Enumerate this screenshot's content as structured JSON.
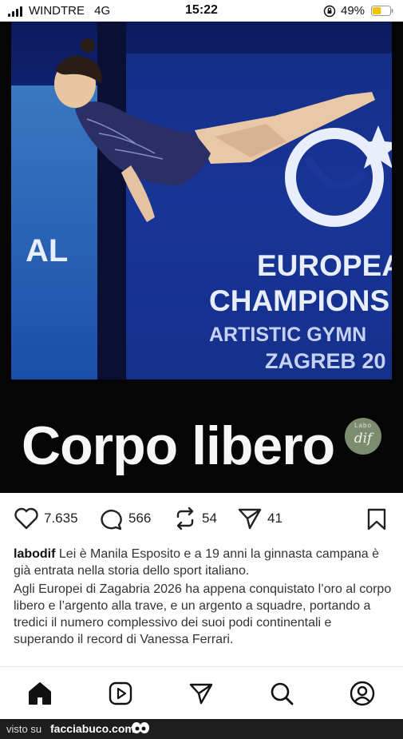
{
  "status_bar": {
    "carrier": "WINDTRE",
    "network": "4G",
    "time": "15:22",
    "battery_percent": "49%",
    "battery_level": 0.49
  },
  "post": {
    "overlay_title": "Corpo libero",
    "photo_text": {
      "line1": "EUROPEA",
      "line2": "CHAMPIONS",
      "line3": "ARTISTIC GYMN",
      "line4": "ZAGREB 20",
      "side": "AL"
    },
    "logo": {
      "top": "Labo",
      "mark": "dif"
    }
  },
  "actions": {
    "likes": "7.635",
    "comments": "566",
    "reposts": "54",
    "shares": "41"
  },
  "caption": {
    "username": "labodif",
    "first_para": "Lei è Manila Esposito e a 19 anni la ginnasta campana è già entrata nella storia dello sport italiano.",
    "second_para": "Agli Europei di Zagabria 2026 ha appena conquistato l’oro al corpo libero e l’argento alla trave, e un argento a squadre, portando a tredici il numero complessivo dei suoi podi continentali e superando il record di Vanessa Ferrari."
  },
  "footer": {
    "visto_su": "visto su",
    "site": "facciabuco.com"
  },
  "colors": {
    "photo_bg": "#13257a",
    "emblem": "#e9eefc",
    "logo_badge": "#7d8b6f",
    "footer_bg": "#1e1e1e"
  }
}
